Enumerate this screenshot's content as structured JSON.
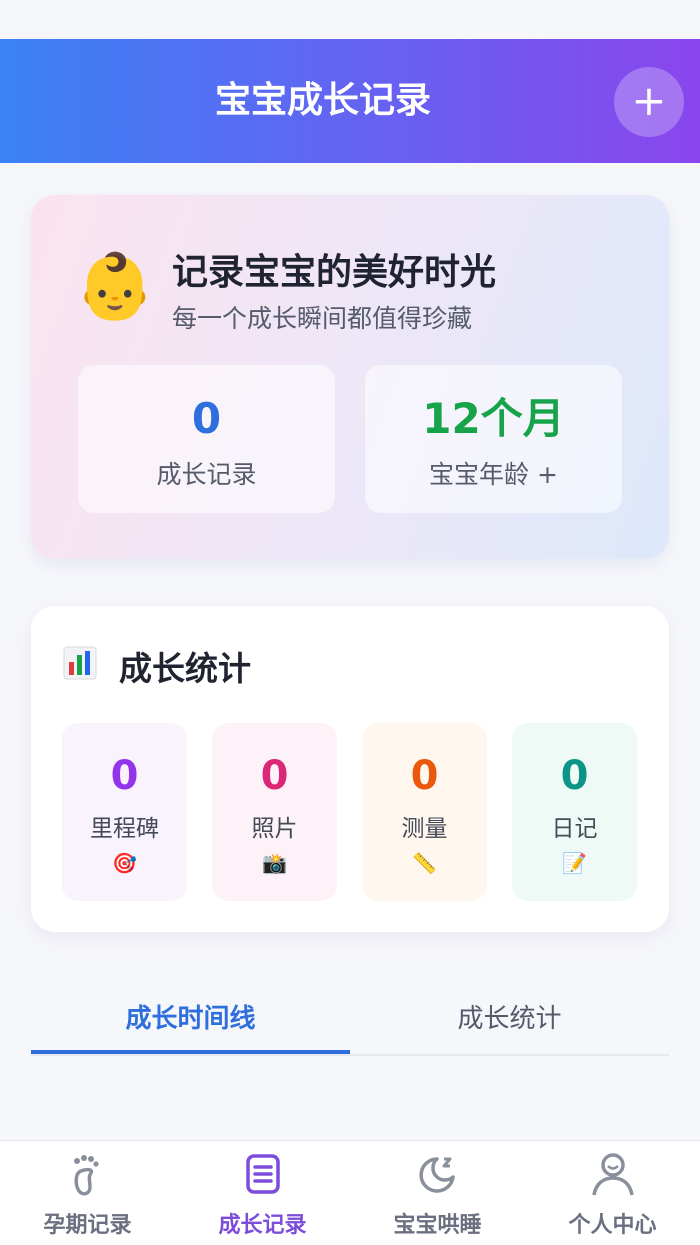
{
  "header": {
    "title": "宝宝成长记录",
    "add_label": "+"
  },
  "hero": {
    "emoji": "👶",
    "title": "记录宝宝的美好时光",
    "subtitle": "每一个成长瞬间都值得珍藏",
    "records": {
      "value": "0",
      "label": "成长记录",
      "color": "#2f6fdd"
    },
    "age": {
      "value": "12个月",
      "label": "宝宝年龄 +",
      "color": "#16a34a"
    }
  },
  "stats": {
    "title": "成长统计",
    "icon": "bar-chart-icon",
    "items": [
      {
        "value": "0",
        "label": "里程碑",
        "emoji": "🎯",
        "color": "#9333ea",
        "bg": "#f8f3fd"
      },
      {
        "value": "0",
        "label": "照片",
        "emoji": "📸",
        "color": "#db2777",
        "bg": "#fdf2f7"
      },
      {
        "value": "0",
        "label": "测量",
        "emoji": "📏",
        "color": "#ea580c",
        "bg": "#fff6ee"
      },
      {
        "value": "0",
        "label": "日记",
        "emoji": "📝",
        "color": "#0d9488",
        "bg": "#effaf6"
      }
    ]
  },
  "tabs": [
    {
      "label": "成长时间线",
      "active": true
    },
    {
      "label": "成长统计",
      "active": false
    }
  ],
  "nav": [
    {
      "label": "孕期记录",
      "icon": "footprint-icon",
      "active": false
    },
    {
      "label": "成长记录",
      "icon": "notebook-icon",
      "active": true
    },
    {
      "label": "宝宝哄睡",
      "icon": "moon-icon",
      "active": false
    },
    {
      "label": "个人中心",
      "icon": "user-icon",
      "active": false
    }
  ]
}
